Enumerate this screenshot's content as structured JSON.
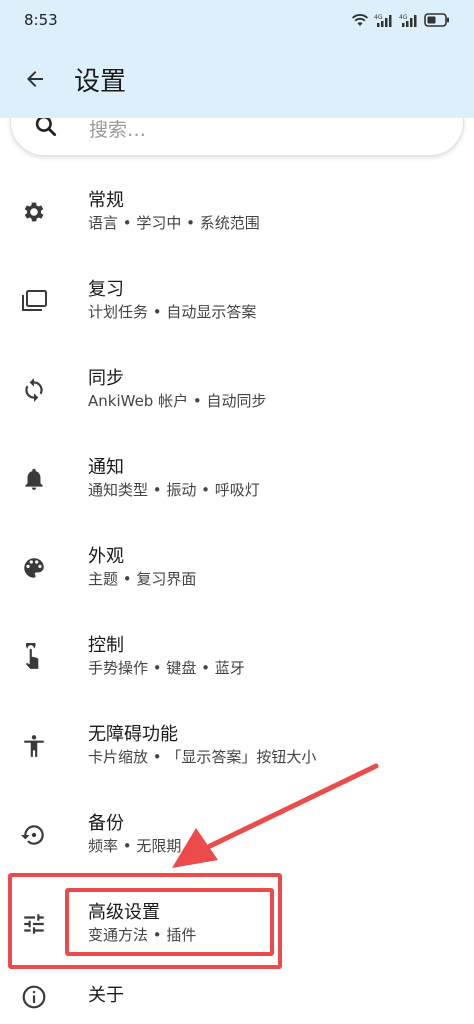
{
  "status": {
    "time": "8:53"
  },
  "appbar": {
    "title": "设置"
  },
  "search": {
    "placeholder": "搜索…"
  },
  "items": [
    {
      "title": "常规",
      "subtitle": "语言 • 学习中 • 系统范围",
      "icon": "gear-icon"
    },
    {
      "title": "复习",
      "subtitle": "计划任务 • 自动显示答案",
      "icon": "cards-icon"
    },
    {
      "title": "同步",
      "subtitle": "AnkiWeb 帐户 • 自动同步",
      "icon": "sync-icon"
    },
    {
      "title": "通知",
      "subtitle": "通知类型 • 振动 • 呼吸灯",
      "icon": "bell-icon"
    },
    {
      "title": "外观",
      "subtitle": "主题 • 复习界面",
      "icon": "palette-icon"
    },
    {
      "title": "控制",
      "subtitle": "手势操作 • 键盘 • 蓝牙",
      "icon": "touch-icon"
    },
    {
      "title": "无障碍功能",
      "subtitle": "卡片缩放 • 「显示答案」按钮大小",
      "icon": "accessibility-icon"
    },
    {
      "title": "备份",
      "subtitle": "频率 • 无限期",
      "icon": "backup-restore-icon"
    },
    {
      "title": "高级设置",
      "subtitle": "变通方法 • 插件",
      "icon": "tune-icon"
    },
    {
      "title": "关于",
      "subtitle": "",
      "icon": "info-icon"
    }
  ],
  "colors": {
    "appbar_bg": "#ddeffb",
    "highlight": "#ec4b4b"
  }
}
